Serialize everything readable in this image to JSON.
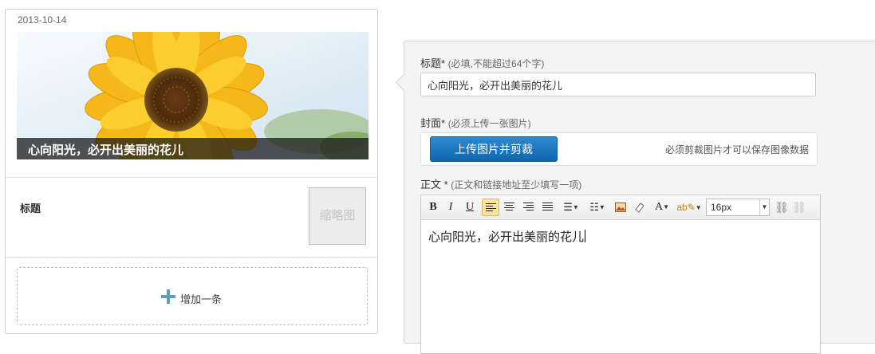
{
  "preview": {
    "date": "2013-10-14",
    "cover_title": "心向阳光，必开出美丽的花儿",
    "item_title": "标题",
    "thumbnail_placeholder": "缩略图",
    "add_item_label": "增加一条"
  },
  "form": {
    "title_label": "标题*",
    "title_hint": "(必填,不能超过64个字)",
    "title_value": "心向阳光，必开出美丽的花儿",
    "cover_label": "封面*",
    "cover_hint": "(必须上传一张图片)",
    "upload_button": "上传图片并剪裁",
    "upload_note": "必须剪裁图片才可以保存图像数据",
    "body_label": "正文 *",
    "body_hint": "(正文和链接地址至少填写一项)",
    "body_content": "心向阳光，必开出美丽的花儿"
  },
  "toolbar": {
    "bold": "B",
    "italic": "I",
    "underline": "U",
    "font_color": "A",
    "font_size": "16px",
    "font_size_options": [
      "16px"
    ],
    "active_button": "align-left"
  },
  "colors": {
    "upload_button": "#1a73bd",
    "active_toolbar": "#fbe3a4",
    "add_icon": "#5f9ec0"
  }
}
